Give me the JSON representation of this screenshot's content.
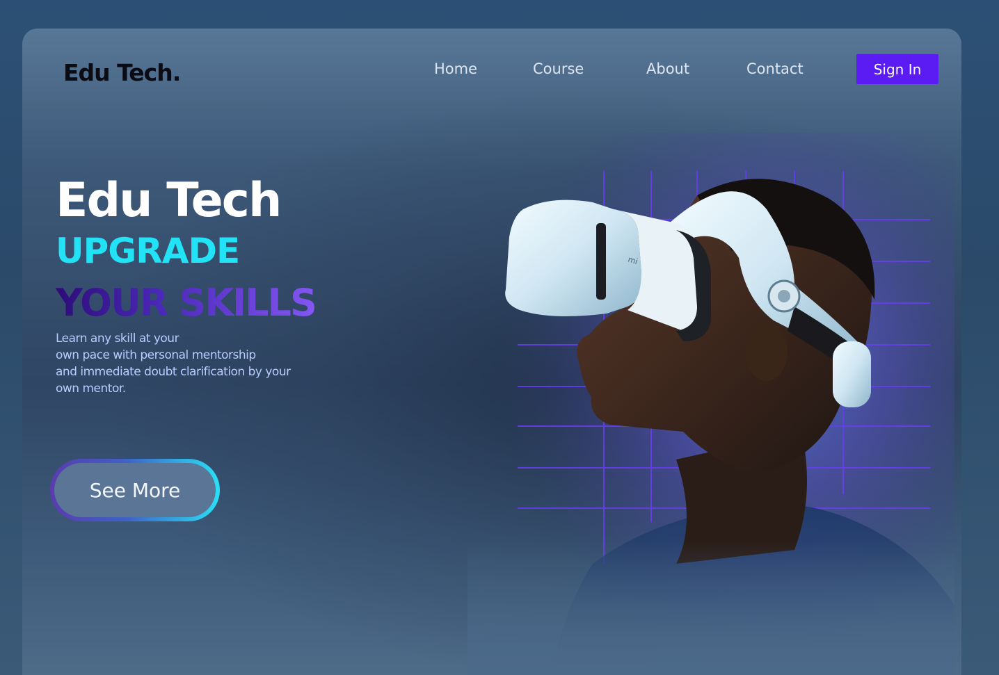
{
  "brand": {
    "logo": "Edu Tech."
  },
  "nav": {
    "items": [
      {
        "label": "Home"
      },
      {
        "label": "Course"
      },
      {
        "label": "About"
      },
      {
        "label": "Contact"
      }
    ],
    "signin_label": "Sign In"
  },
  "hero": {
    "title": "Edu Tech",
    "subtitle1": "UPGRADE",
    "subtitle2": "YOUR SKILLS",
    "description_lines": [
      "Learn any skill at your",
      "own pace with personal mentorship",
      "and immediate doubt clarification by your",
      "own mentor."
    ],
    "cta_label": "See More"
  },
  "colors": {
    "accent_cyan": "#22e3f5",
    "accent_purple": "#5b1cf3",
    "text_light": "#dfe6f2"
  },
  "icons": {
    "hero_image": "vr-headset-person"
  }
}
